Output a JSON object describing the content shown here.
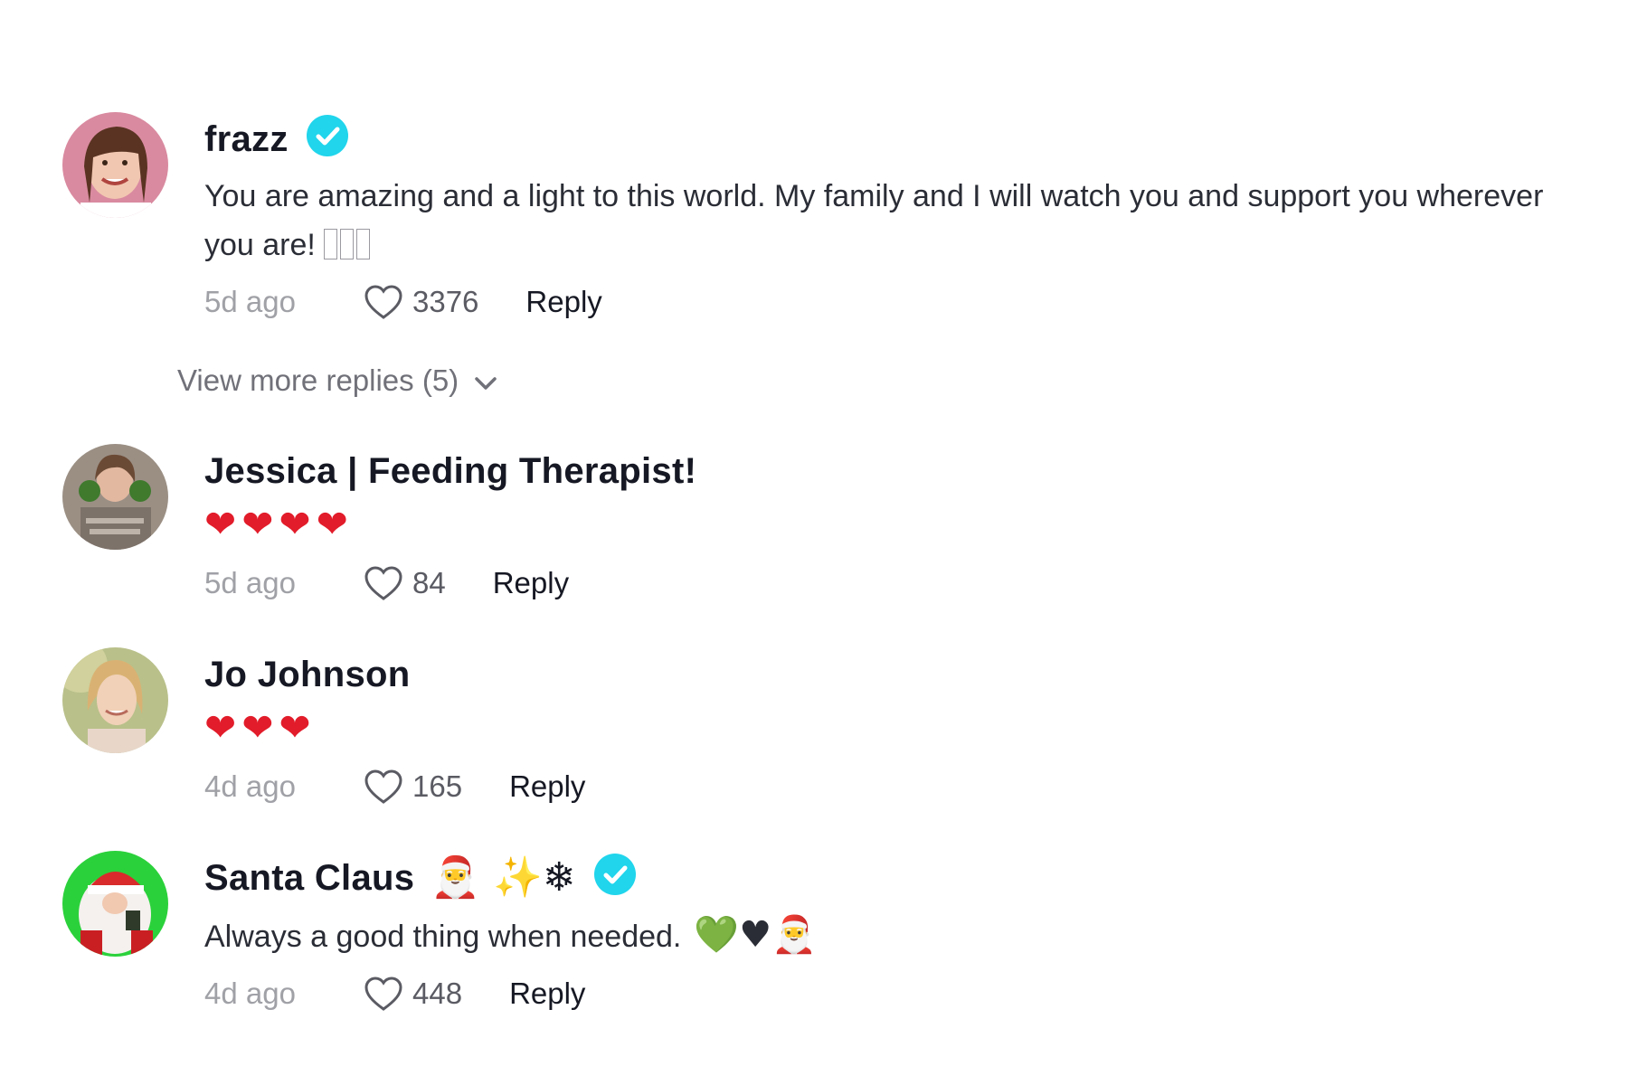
{
  "comments": [
    {
      "username": "frazz",
      "verified": true,
      "name_emoji": "",
      "text": "You are amazing and a light to this world. My family and I will watch you and support you wherever you are!",
      "text_trailing_placeholders": 3,
      "time": "5d ago",
      "likes": "3376",
      "reply_label": "Reply"
    },
    {
      "username": "Jessica | Feeding Therapist!",
      "verified": false,
      "text_emoji": "❤❤❤❤",
      "time": "5d ago",
      "likes": "84",
      "reply_label": "Reply"
    },
    {
      "username": "Jo Johnson",
      "verified": false,
      "text_emoji": "❤❤❤",
      "time": "4d ago",
      "likes": "165",
      "reply_label": "Reply"
    },
    {
      "username": "Santa Claus",
      "verified": true,
      "name_emoji": "🎅 ✨❄",
      "text": "Always a good thing when needed.",
      "text_emoji": "💚♥🎅",
      "time": "4d ago",
      "likes": "448",
      "reply_label": "Reply"
    }
  ],
  "view_more_replies": "View more replies (5)",
  "colors": {
    "verified": "#20d5ec",
    "text": "#161823",
    "muted": "#a0a1a7",
    "heart_red": "#e21c2a"
  }
}
